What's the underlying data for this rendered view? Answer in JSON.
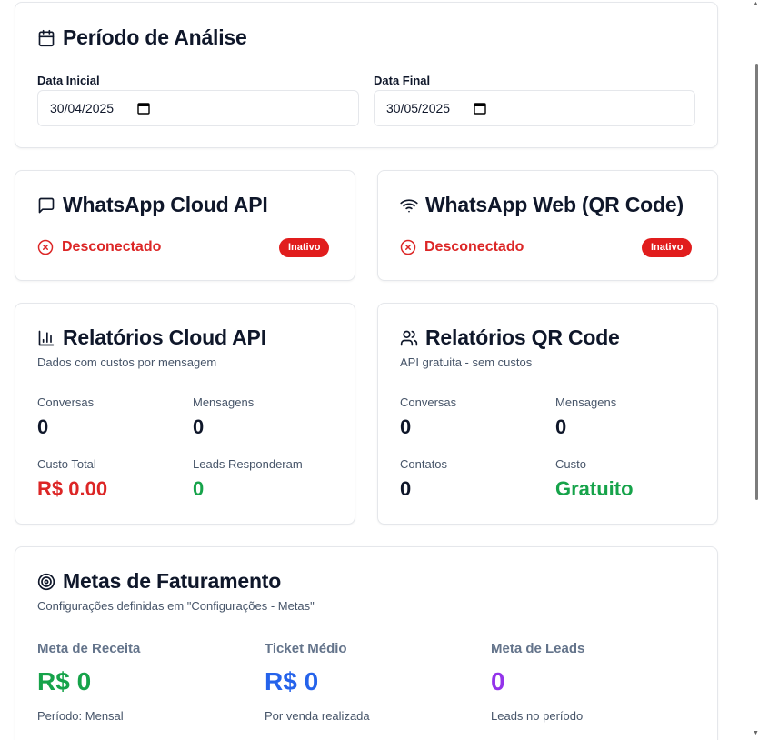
{
  "period": {
    "title": "Período de Análise",
    "start_label": "Data Inicial",
    "start_value": "30/04/2025",
    "end_label": "Data Final",
    "end_value": "30/05/2025"
  },
  "cloud_api": {
    "title": "WhatsApp Cloud API",
    "status": "Desconectado",
    "badge": "Inativo"
  },
  "web_qr": {
    "title": "WhatsApp Web (QR Code)",
    "status": "Desconectado",
    "badge": "Inativo"
  },
  "cloud_reports": {
    "title": "Relatórios Cloud API",
    "subtitle": "Dados com custos por mensagem",
    "stats": [
      {
        "label": "Conversas",
        "value": "0"
      },
      {
        "label": "Mensagens",
        "value": "0"
      },
      {
        "label": "Custo Total",
        "value": "R$ 0.00"
      },
      {
        "label": "Leads Responderam",
        "value": "0"
      }
    ]
  },
  "qr_reports": {
    "title": "Relatórios QR Code",
    "subtitle": "API gratuita - sem custos",
    "stats": [
      {
        "label": "Conversas",
        "value": "0"
      },
      {
        "label": "Mensagens",
        "value": "0"
      },
      {
        "label": "Contatos",
        "value": "0"
      },
      {
        "label": "Custo",
        "value": "Gratuito"
      }
    ]
  },
  "goals": {
    "title": "Metas de Faturamento",
    "subtitle": "Configurações definidas em \"Configurações - Metas\"",
    "items": [
      {
        "label": "Meta de Receita",
        "value": "R$ 0",
        "note": "Período: Mensal"
      },
      {
        "label": "Ticket Médio",
        "value": "R$ 0",
        "note": "Por venda realizada"
      },
      {
        "label": "Meta de Leads",
        "value": "0",
        "note": "Leads no período"
      }
    ]
  },
  "colors": {
    "danger": "#dc2626",
    "success": "#16a34a",
    "info": "#2563eb",
    "accent": "#9333ea"
  }
}
